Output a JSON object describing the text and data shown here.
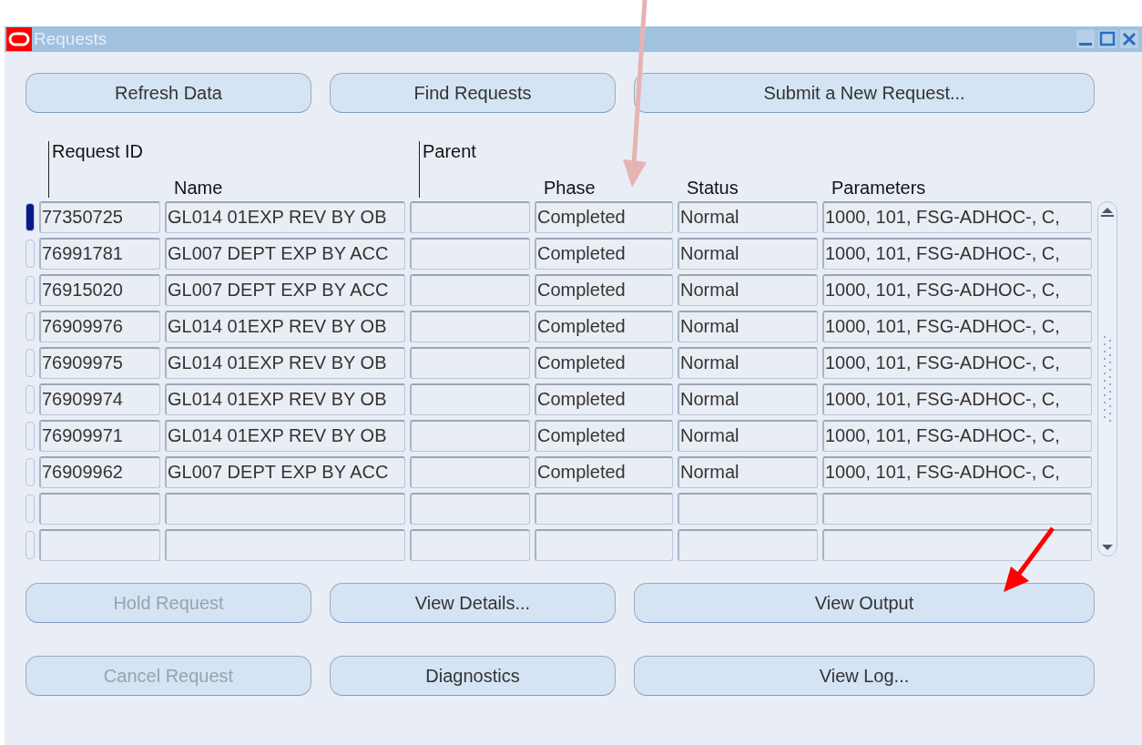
{
  "window": {
    "title": "Requests"
  },
  "top_buttons": [
    {
      "label": "Refresh Data",
      "disabled": false
    },
    {
      "label": "Find Requests",
      "disabled": false
    },
    {
      "label": "Submit a New Request...",
      "disabled": false
    }
  ],
  "table": {
    "columns": [
      {
        "label": "Request ID",
        "kind": "upper"
      },
      {
        "label": "Name",
        "kind": "lower"
      },
      {
        "label": "Parent",
        "kind": "upper"
      },
      {
        "label": "Phase",
        "kind": "lower"
      },
      {
        "label": "Status",
        "kind": "lower"
      },
      {
        "label": "Parameters",
        "kind": "lower"
      }
    ],
    "rows": [
      {
        "selected": true,
        "cells": [
          "77350725",
          "GL014 01EXP REV BY OB",
          "",
          "Completed",
          "Normal",
          "1000, 101, FSG-ADHOC-, C,"
        ]
      },
      {
        "selected": false,
        "cells": [
          "76991781",
          "GL007 DEPT EXP BY ACC",
          "",
          "Completed",
          "Normal",
          "1000, 101, FSG-ADHOC-, C,"
        ]
      },
      {
        "selected": false,
        "cells": [
          "76915020",
          "GL007 DEPT EXP BY ACC",
          "",
          "Completed",
          "Normal",
          "1000, 101, FSG-ADHOC-, C,"
        ]
      },
      {
        "selected": false,
        "cells": [
          "76909976",
          "GL014 01EXP REV BY OB",
          "",
          "Completed",
          "Normal",
          "1000, 101, FSG-ADHOC-, C,"
        ]
      },
      {
        "selected": false,
        "cells": [
          "76909975",
          "GL014 01EXP REV BY OB",
          "",
          "Completed",
          "Normal",
          "1000, 101, FSG-ADHOC-, C,"
        ]
      },
      {
        "selected": false,
        "cells": [
          "76909974",
          "GL014 01EXP REV BY OB",
          "",
          "Completed",
          "Normal",
          "1000, 101, FSG-ADHOC-, C,"
        ]
      },
      {
        "selected": false,
        "cells": [
          "76909971",
          "GL014 01EXP REV BY OB",
          "",
          "Completed",
          "Normal",
          "1000, 101, FSG-ADHOC-, C,"
        ]
      },
      {
        "selected": false,
        "cells": [
          "76909962",
          "GL007 DEPT EXP BY ACC",
          "",
          "Completed",
          "Normal",
          "1000, 101, FSG-ADHOC-, C,"
        ]
      }
    ]
  },
  "bottom_buttons": [
    {
      "label": "Hold Request",
      "disabled": true
    },
    {
      "label": "View Details...",
      "disabled": false
    },
    {
      "label": "View Output",
      "disabled": false
    },
    {
      "label": "Cancel Request",
      "disabled": true
    },
    {
      "label": "Diagnostics",
      "disabled": false
    },
    {
      "label": "View Log...",
      "disabled": false
    }
  ],
  "annotations": [
    {
      "kind": "down",
      "color": "#e6b3b3"
    },
    {
      "kind": "downleft",
      "color": "#ff0000"
    }
  ]
}
